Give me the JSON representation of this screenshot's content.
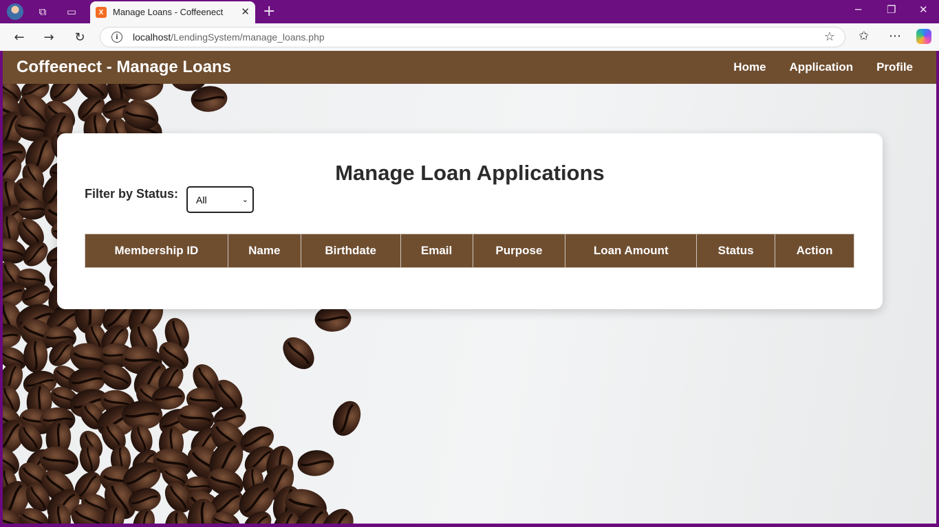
{
  "browser": {
    "tab_title": "Manage Loans - Coffeenect",
    "tab_favicon_text": "X",
    "url_host": "localhost",
    "url_path": "/LendingSystem/manage_loans.php"
  },
  "navbar": {
    "brand": "Coffeenect - Manage Loans",
    "links": [
      "Home",
      "Application",
      "Profile"
    ]
  },
  "main": {
    "title": "Manage Loan Applications",
    "filter_label": "Filter by Status:",
    "filter_value": "All"
  },
  "table": {
    "headers": [
      "Membership ID",
      "Name",
      "Birthdate",
      "Email",
      "Purpose",
      "Loan Amount",
      "Status",
      "Action"
    ],
    "rows": []
  },
  "colors": {
    "browser_frame": "#6c0f80",
    "brand_brown": "#6f4e30"
  }
}
